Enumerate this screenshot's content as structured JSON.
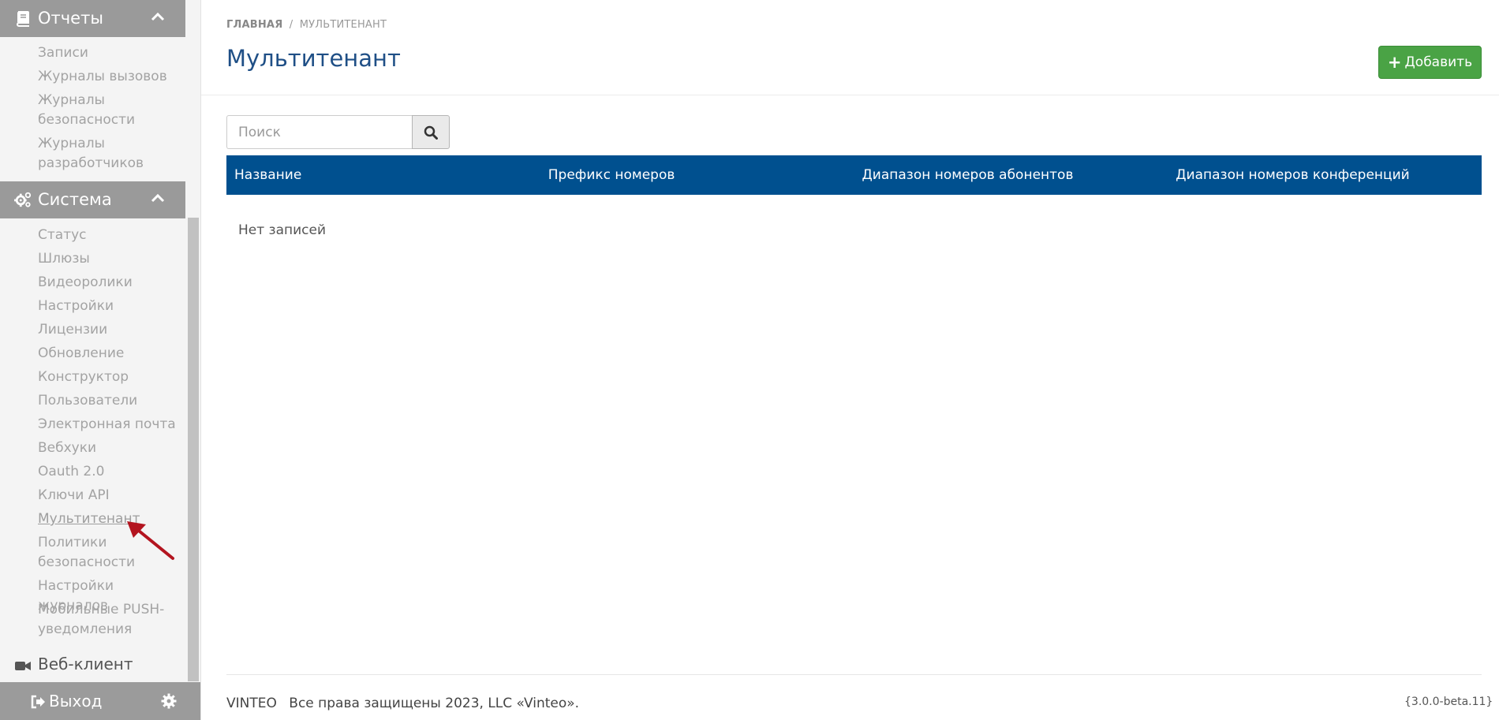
{
  "sidebar": {
    "reports": {
      "title": "Отчеты",
      "items": [
        "Записи",
        "Журналы вызовов",
        "Журналы безопасности",
        "Журналы разработчиков"
      ]
    },
    "system": {
      "title": "Система",
      "items": [
        "Статус",
        "Шлюзы",
        "Видеоролики",
        "Настройки",
        "Лицензии",
        "Обновление",
        "Конструктор",
        "Пользователи",
        "Электронная почта",
        "Вебхуки",
        "Oauth 2.0",
        "Ключи API",
        "Мультитенант",
        "Политики безопасности",
        "Настройки журналов",
        "Мобильные PUSH-уведомления"
      ],
      "active": "Мультитенант"
    },
    "webclient": {
      "label": "Веб-клиент"
    },
    "logout": {
      "label": "Выход"
    }
  },
  "header": {
    "breadcrumb_home": "ГЛАВНАЯ",
    "breadcrumb_sep": "/",
    "breadcrumb_current": "МУЛЬТИТЕНАНТ",
    "title": "Мультитенант",
    "add_label": "Добавить"
  },
  "search": {
    "placeholder": "Поиск",
    "value": ""
  },
  "table": {
    "columns": [
      "Название",
      "Префикс номеров",
      "Диапазон номеров абонентов",
      "Диапазон номеров конференций"
    ],
    "empty_text": "Нет записей"
  },
  "footer": {
    "brand": "VINTEO",
    "copyright": "Все права защищены 2023, LLC «Vinteo».",
    "version": "{3.0.0-beta.11}"
  },
  "colors": {
    "table_header": "#00508f",
    "title": "#1f4f86",
    "add_button": "#4aa345",
    "sidebar_header": "#9a9a9a",
    "annotation_arrow": "#b3141f"
  },
  "icons": {
    "reports": "book-icon",
    "system": "cogs-icon",
    "webclient": "video-camera-icon",
    "logout": "sign-out-icon",
    "settings": "gear-icon",
    "search": "search-icon",
    "add": "plus-icon"
  }
}
